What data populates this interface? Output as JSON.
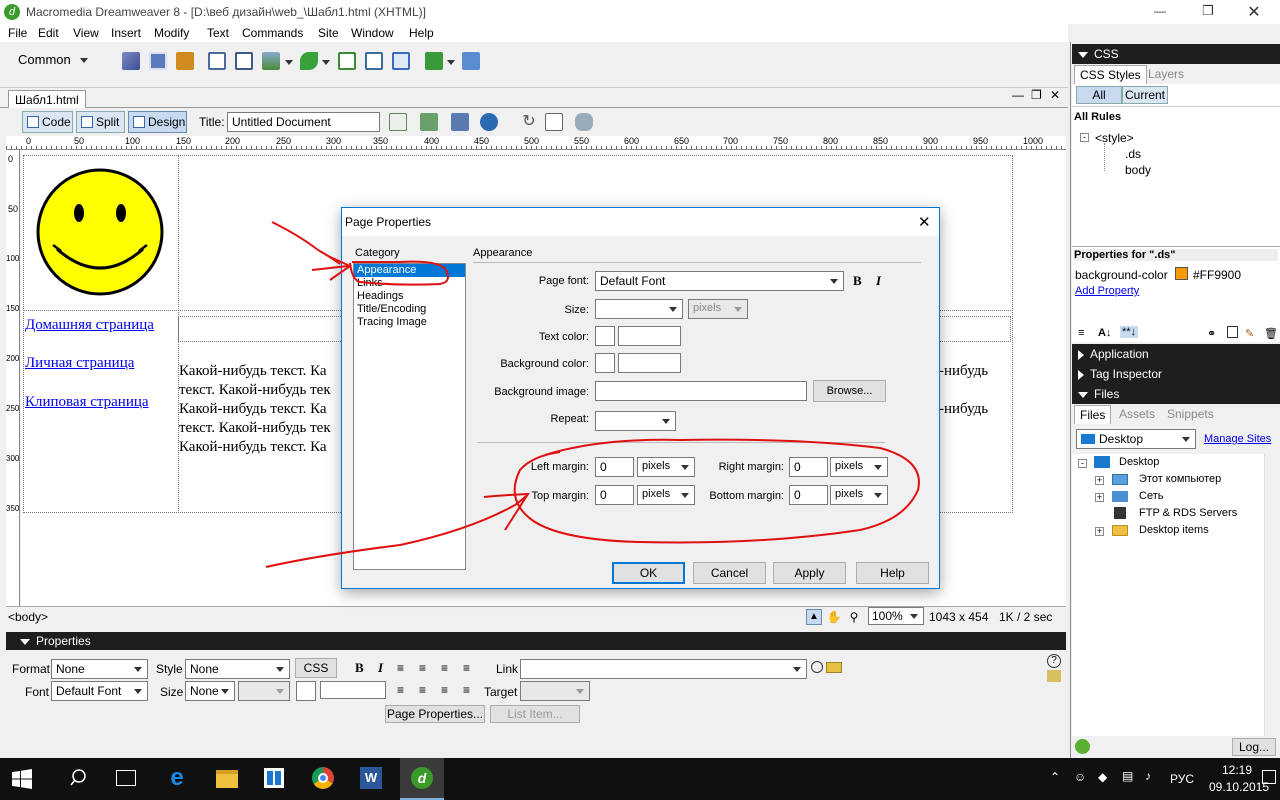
{
  "window": {
    "title": "Macromedia Dreamweaver 8 - [D:\\веб дизайн\\web_\\Шабл1.html (XHTML)]"
  },
  "menu": [
    "File",
    "Edit",
    "View",
    "Insert",
    "Modify",
    "Text",
    "Commands",
    "Site",
    "Window",
    "Help"
  ],
  "insert_bar": {
    "category": "Common"
  },
  "doc": {
    "tab": "Шабл1.html",
    "view_buttons": {
      "code": "Code",
      "split": "Split",
      "design": "Design"
    },
    "title_label": "Title:",
    "title_value": "Untitled Document",
    "ruler_ticks": [
      "0",
      "50",
      "100",
      "150",
      "200",
      "250",
      "300",
      "350",
      "400",
      "450",
      "500",
      "550",
      "600",
      "650",
      "700",
      "750",
      "800",
      "850",
      "900",
      "950",
      "1000"
    ],
    "vruler_ticks": [
      "0",
      "50",
      "100",
      "150",
      "200",
      "250",
      "300",
      "350"
    ],
    "links": [
      "Домашняя страница",
      "Личная страница",
      "Клиповая страница"
    ],
    "body_text_lines": [
      "Какой-нибудь текст. Ка",
      "текст. Какой-нибудь тек",
      "Какой-нибудь текст. Ка",
      "текст. Какой-нибудь тек",
      "Какой-нибудь текст. Ка"
    ],
    "right_text_lines": [
      "-нибудь",
      "",
      "-нибудь"
    ]
  },
  "status": {
    "tag": "<body>",
    "zoom": "100%",
    "size": "1043 x 454",
    "speed": "1K / 2 sec"
  },
  "dialog": {
    "title": "Page Properties",
    "category_label": "Category",
    "categories": [
      "Appearance",
      "Links",
      "Headings",
      "Title/Encoding",
      "Tracing Image"
    ],
    "section": "Appearance",
    "page_font_label": "Page font:",
    "page_font": "Default Font",
    "size_label": "Size:",
    "size_unit": "pixels",
    "text_color_label": "Text color:",
    "bg_color_label": "Background color:",
    "bg_image_label": "Background image:",
    "browse": "Browse...",
    "repeat_label": "Repeat:",
    "left_margin_label": "Left margin:",
    "left_margin": "0",
    "right_margin_label": "Right margin:",
    "right_margin": "0",
    "top_margin_label": "Top margin:",
    "top_margin": "0",
    "bottom_margin_label": "Bottom margin:",
    "bottom_margin": "0",
    "unit": "pixels",
    "ok": "OK",
    "cancel": "Cancel",
    "apply": "Apply",
    "help": "Help"
  },
  "properties": {
    "header": "Properties",
    "format_label": "Format",
    "format": "None",
    "style_label": "Style",
    "style": "None",
    "css": "CSS",
    "link_label": "Link",
    "font_label": "Font",
    "font": "Default Font",
    "size_label": "Size",
    "size": "None",
    "target_label": "Target",
    "page_props": "Page Properties...",
    "list_item": "List Item..."
  },
  "css_panel": {
    "header": "CSS",
    "tabs": [
      "CSS Styles",
      "Layers"
    ],
    "modes": [
      "All",
      "Current"
    ],
    "all_rules": "All Rules",
    "rules": [
      "<style>",
      ".ds",
      "body"
    ],
    "props_title": "Properties for \".ds\"",
    "prop_name": "background-color",
    "prop_value": "#FF9900",
    "prop_color": "#FF9900",
    "add_property": "Add Property"
  },
  "application": "Application",
  "tag_inspector": "Tag Inspector",
  "files_panel": {
    "header": "Files",
    "tabs": [
      "Files",
      "Assets",
      "Snippets"
    ],
    "location": "Desktop",
    "manage": "Manage Sites",
    "tree": [
      "Desktop",
      "Этот компьютер",
      "Сеть",
      "FTP & RDS Servers",
      "Desktop items"
    ],
    "log": "Log..."
  },
  "taskbar": {
    "lang": "РУС",
    "time": "12:19",
    "date": "09.10.2015"
  }
}
